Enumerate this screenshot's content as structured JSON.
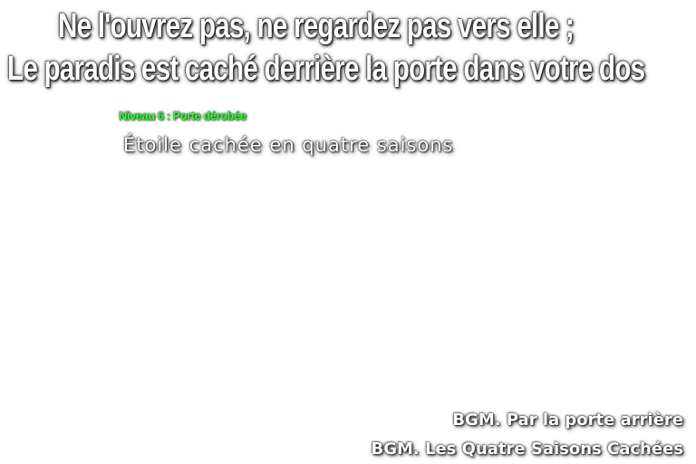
{
  "intro": {
    "line1": "Ne l'ouvrez pas, ne regardez pas vers elle ;",
    "line2": "Le paradis est caché derrière la porte dans votre dos"
  },
  "stage": {
    "label": "Niveau 6 : Porte dérobée",
    "title": "Étoile cachée en quatre saisons"
  },
  "bgm": {
    "track1": "BGM. Par la porte arrière",
    "track2": "BGM. Les Quatre Saisons Cachées"
  },
  "colors": {
    "background": "#ffffff",
    "text": "#ffffff",
    "stage_label": "#33ff33"
  }
}
